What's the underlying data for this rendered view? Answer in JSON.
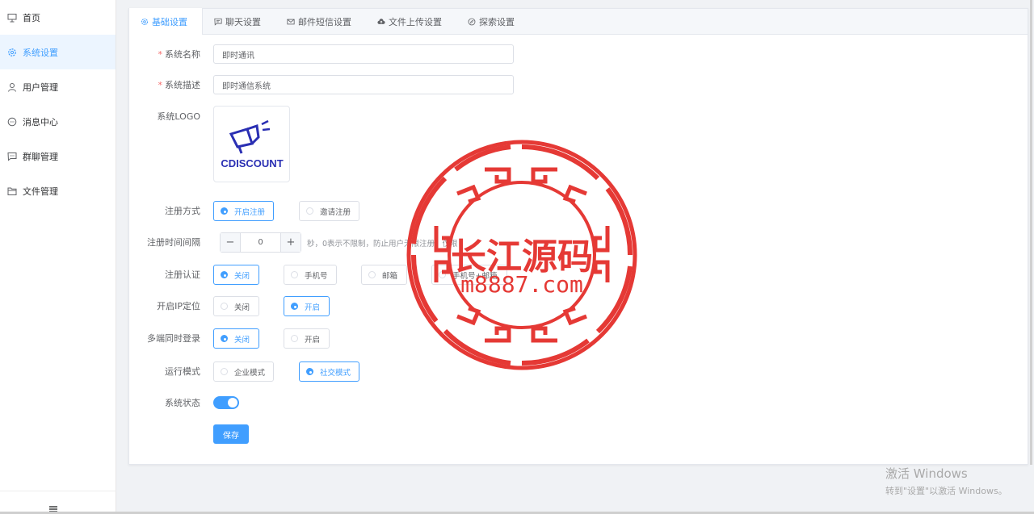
{
  "sidebar": {
    "items": [
      {
        "label": "首页",
        "icon": "presentation-icon"
      },
      {
        "label": "系统设置",
        "icon": "gear-icon"
      },
      {
        "label": "用户管理",
        "icon": "user-icon"
      },
      {
        "label": "消息中心",
        "icon": "chat-bubble-icon"
      },
      {
        "label": "群聊管理",
        "icon": "chat-square-icon"
      },
      {
        "label": "文件管理",
        "icon": "folder-icon"
      }
    ]
  },
  "tabs": [
    {
      "label": "基础设置",
      "icon": "gear-icon"
    },
    {
      "label": "聊天设置",
      "icon": "chat-square-icon"
    },
    {
      "label": "邮件短信设置",
      "icon": "mail-icon"
    },
    {
      "label": "文件上传设置",
      "icon": "cloud-upload-icon"
    },
    {
      "label": "探索设置",
      "icon": "compass-icon"
    }
  ],
  "form": {
    "system_name": {
      "label": "系统名称",
      "value": "即时通讯"
    },
    "system_desc": {
      "label": "系统描述",
      "value": "即时通信系统"
    },
    "system_logo": {
      "label": "系统LOGO",
      "logo_text": "CDISCOUNT"
    },
    "register_mode": {
      "label": "注册方式",
      "options": [
        "开启注册",
        "邀请注册"
      ],
      "selected": 0
    },
    "register_interval": {
      "label": "注册时间间隔",
      "value": "0",
      "hint": "秒，0表示不限制，防止用户无限注册，仅限"
    },
    "register_auth": {
      "label": "注册认证",
      "options": [
        "关闭",
        "手机号",
        "邮箱",
        "手机号+邮箱"
      ],
      "selected": 0
    },
    "ip_location": {
      "label": "开启IP定位",
      "options": [
        "关闭",
        "开启"
      ],
      "selected": 1
    },
    "multi_login": {
      "label": "多端同时登录",
      "options": [
        "关闭",
        "开启"
      ],
      "selected": 0
    },
    "run_mode": {
      "label": "运行模式",
      "options": [
        "企业模式",
        "社交模式"
      ],
      "selected": 1
    },
    "system_status": {
      "label": "系统状态",
      "on": true
    },
    "save_label": "保存"
  },
  "watermark": {
    "stamp_title": "长江源码",
    "stamp_url": "m8887.com",
    "color": "#e53935"
  },
  "windows_activation": {
    "line1": "激活 Windows",
    "line2": "转到\"设置\"以激活 Windows。"
  },
  "colors": {
    "accent": "#409eff",
    "required": "#f56c6c"
  }
}
